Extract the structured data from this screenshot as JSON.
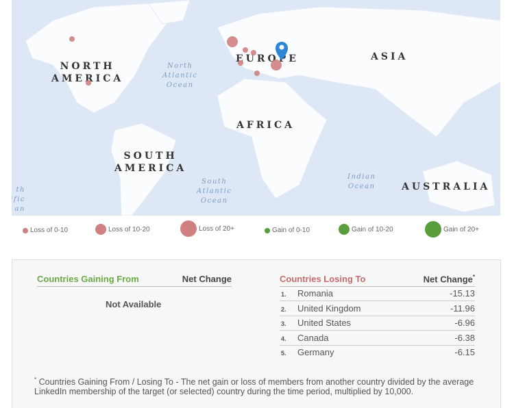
{
  "map": {
    "continents": [
      "NORTH\nAMERICA",
      "EUROPE",
      "ASIA",
      "AFRICA",
      "SOUTH\nAMERICA",
      "AUSTRALIA"
    ],
    "oceans": [
      "North\nAtlantic\nOcean",
      "South\nAtlantic\nOcean",
      "Indian\nOcean",
      "th\nific\nan"
    ],
    "pin_icon": "map-marker-icon",
    "bubble_color": "#d08080",
    "pin_color": "#2e86d6"
  },
  "legend": [
    {
      "label": "Loss of 0-10",
      "color": "#d08080"
    },
    {
      "label": "Loss of 10-20",
      "color": "#d08080"
    },
    {
      "label": "Loss of 20+",
      "color": "#d08080"
    },
    {
      "label": "Gain of 0-10",
      "color": "#5a9e3c"
    },
    {
      "label": "Gain of 10-20",
      "color": "#5a9e3c"
    },
    {
      "label": "Gain of 20+",
      "color": "#5a9e3c"
    }
  ],
  "gaining": {
    "title": "Countries Gaining From",
    "net_label": "Net Change",
    "empty": "Not Available",
    "color": "#6aaa45"
  },
  "losing": {
    "title": "Countries Losing To",
    "net_label": "Net Change",
    "asterisk": "*",
    "color": "#c96b6b",
    "rows": [
      {
        "rank": "1.",
        "country": "Romania",
        "value": "-15.13"
      },
      {
        "rank": "2.",
        "country": "United Kingdom",
        "value": "-11.96"
      },
      {
        "rank": "3.",
        "country": "United States",
        "value": "-6.96"
      },
      {
        "rank": "4.",
        "country": "Canada",
        "value": "-6.38"
      },
      {
        "rank": "5.",
        "country": "Germany",
        "value": "-6.15"
      }
    ]
  },
  "footnote": {
    "asterisk": "*",
    "text": " Countries Gaining From / Losing To - The net gain or loss of members from another country divided by the average LinkedIn membership of the target (or selected) country during the time period, multiplied by 10,000."
  }
}
